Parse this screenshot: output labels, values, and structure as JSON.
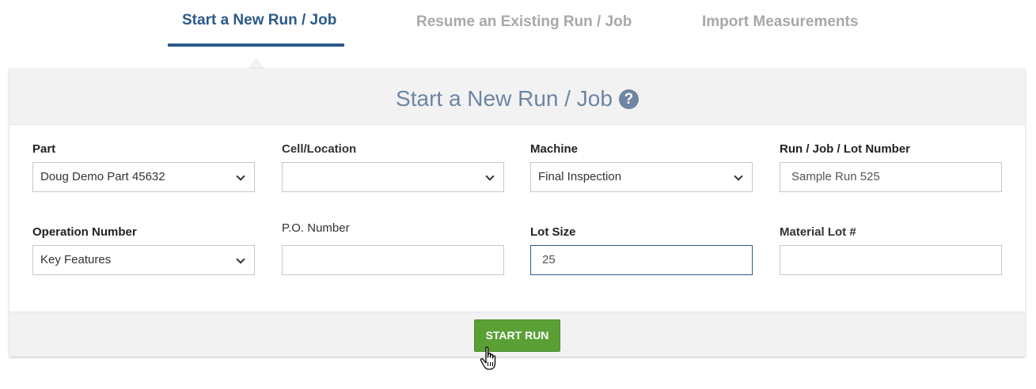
{
  "tabs": [
    {
      "label": "Start a New Run / Job",
      "active": true
    },
    {
      "label": "Resume an Existing Run / Job",
      "active": false
    },
    {
      "label": "Import Measurements",
      "active": false
    }
  ],
  "panel": {
    "title": "Start a New Run / Job",
    "help_icon": "?"
  },
  "fields": {
    "part": {
      "label": "Part",
      "value": "Doug Demo Part 45632"
    },
    "cell_location": {
      "label": "Cell/Location",
      "value": ""
    },
    "machine": {
      "label": "Machine",
      "value": "Final Inspection"
    },
    "run_job_lot": {
      "label": "Run / Job / Lot Number",
      "value": "Sample Run 525"
    },
    "operation_number": {
      "label": "Operation Number",
      "value": "Key Features"
    },
    "po_number": {
      "label": "P.O. Number",
      "value": ""
    },
    "lot_size": {
      "label": "Lot Size",
      "value": "25"
    },
    "material_lot": {
      "label": "Material Lot #",
      "value": ""
    }
  },
  "actions": {
    "start_run": "START RUN"
  },
  "colors": {
    "accent": "#2c5a8a",
    "inactive_tab": "#a8a8a8",
    "title": "#6e85a3",
    "button": "#5aa035"
  }
}
